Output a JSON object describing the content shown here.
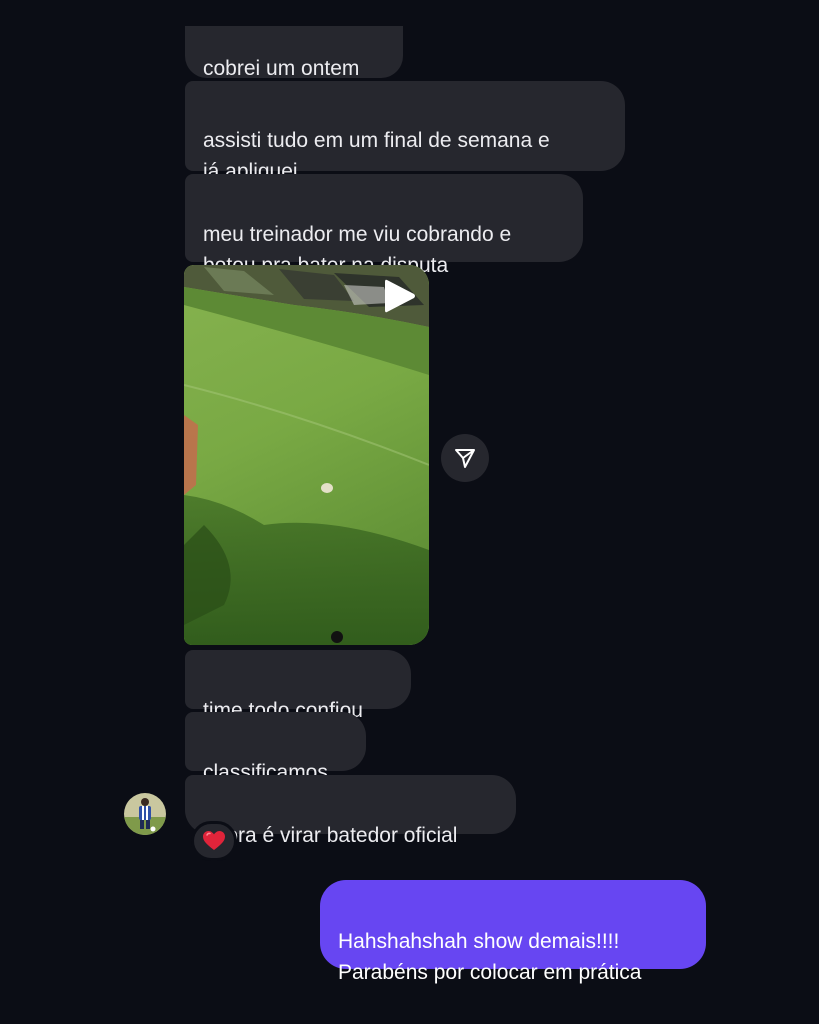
{
  "thread": {
    "incoming": [
      {
        "text": "cobrei um ontem"
      },
      {
        "text": "assisti tudo em um final de semana e\njá apliquei"
      },
      {
        "text": "meu treinador me viu cobrando e\nbotou pra bater na disputa"
      },
      {
        "text": "time todo confiou"
      },
      {
        "text": "classificamos"
      },
      {
        "text": "agora é virar batedor oficial"
      }
    ],
    "video": {
      "play_icon": "play-icon",
      "share_icon": "paper-plane-icon"
    },
    "reaction": {
      "icon": "red-heart-icon",
      "glyph": "❤️",
      "color": "#e0243a"
    },
    "outgoing": [
      {
        "text": "Hahshahshah show demais!!!!\nParabéns por colocar em prática"
      }
    ]
  },
  "colors": {
    "background": "#0b0d15",
    "incoming_bubble": "#26272e",
    "outgoing_bubble": "#6746f2"
  }
}
